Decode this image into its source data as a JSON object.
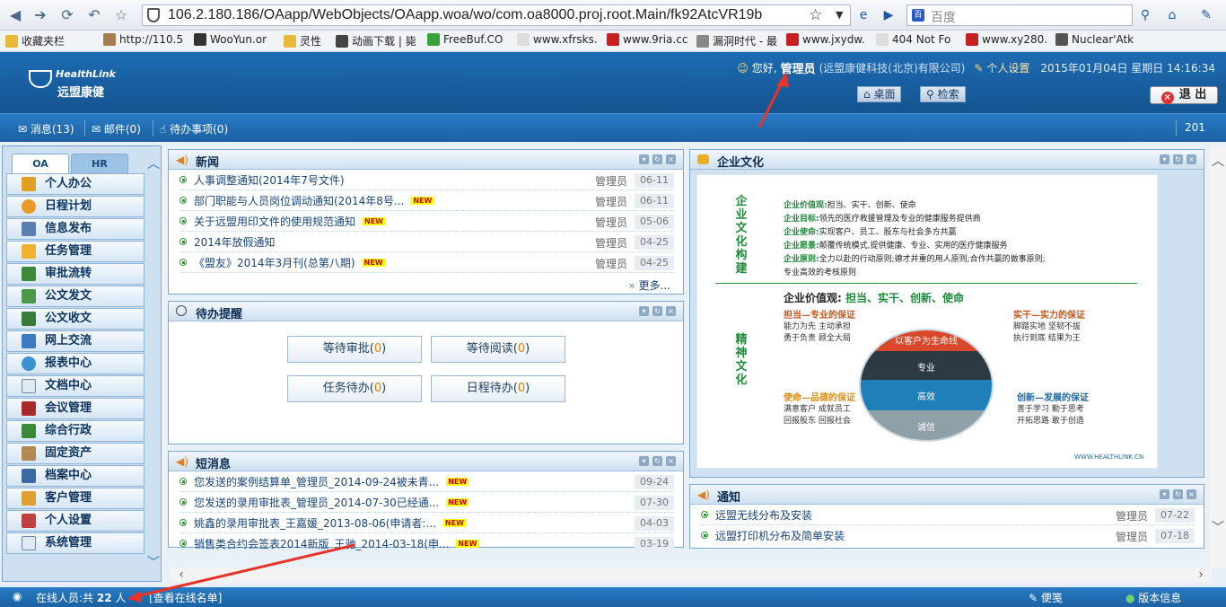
{
  "browser": {
    "url": "106.2.180.186/OAapp/WebObjects/OAapp.woa/wo/com.oa8000.proj.root.Main/fk92AtcVR19b",
    "search_placeholder": "百度",
    "bookmarks": [
      "收藏夹栏",
      "http://110.5",
      "WooYun.or",
      "灵性",
      "动画下载 | 毙",
      "FreeBuf.CO",
      "www.xfrsks.",
      "www.9ria.cc",
      "漏洞时代 - 最",
      "www.jxydw.",
      "404 Not Fo",
      "www.xy280.",
      "Nuclear'Atk"
    ]
  },
  "header": {
    "logo_en": "HealthLink",
    "logo_cn": "远盟康健",
    "greeting": "您好,",
    "username": "管理员",
    "company": "(远盟康健科技(北京)有限公司)",
    "settings": "个人设置",
    "datetime": "2015年01月04日 星期日 14:16:34",
    "desktop_btn": "桌面",
    "search_btn": "检索",
    "logout_btn": "退 出"
  },
  "toolbar": {
    "messages": "消息(13)",
    "mail": "邮件(0)",
    "todo": "待办事项(0)",
    "right_num": "201"
  },
  "sidebar": {
    "tabs": [
      "OA",
      "HR"
    ],
    "items": [
      "个人办公",
      "日程计划",
      "信息发布",
      "任务管理",
      "审批流转",
      "公文发文",
      "公文收文",
      "网上交流",
      "报表中心",
      "文档中心",
      "会议管理",
      "综合行政",
      "固定资产",
      "档案中心",
      "客户管理",
      "个人设置",
      "系统管理"
    ]
  },
  "news": {
    "title": "新闻",
    "rows": [
      {
        "title": "人事调整通知(2014年7号文件)",
        "who": "管理员",
        "date": "06-11",
        "new": ""
      },
      {
        "title": "部门职能与人员岗位调动通知(2014年8号...",
        "who": "管理员",
        "date": "06-11",
        "new": "NEW"
      },
      {
        "title": "关于远盟用印文件的使用规范通知",
        "who": "管理员",
        "date": "05-06",
        "new": "NEW"
      },
      {
        "title": "2014年放假通知",
        "who": "管理员",
        "date": "04-25",
        "new": ""
      },
      {
        "title": "《盟友》2014年3月刊(总第八期)",
        "who": "管理员",
        "date": "04-25",
        "new": "NEW"
      }
    ],
    "more": "更多..."
  },
  "todo": {
    "title": "待办提醒",
    "btn1_label": "等待审批",
    "btn1_count": "0",
    "btn2_label": "等待阅读",
    "btn2_count": "0",
    "btn3_label": "任务待办",
    "btn3_count": "0",
    "btn4_label": "日程待办",
    "btn4_count": "0"
  },
  "sms": {
    "title": "短消息",
    "rows": [
      {
        "title": "您发送的案例结算单_管理员_2014-09-24被未青...",
        "date": "09-24",
        "new": "NEW"
      },
      {
        "title": "您发送的录用审批表_管理员_2014-07-30已经通...",
        "date": "07-30",
        "new": "NEW"
      },
      {
        "title": "姚鑫的录用审批表_王嘉媛_2013-08-06(申请者:...",
        "date": "04-03",
        "new": "NEW"
      },
      {
        "title": "销售类合约会签表2014新版_王驰_2014-03-18(申...",
        "date": "03-19",
        "new": "NEW"
      }
    ]
  },
  "culture": {
    "title": "企业文化",
    "left1": "企业文化构建",
    "left2": "精神文化",
    "lines": [
      {
        "k": "企业价值观:",
        "v": "担当、实干、创新、使命"
      },
      {
        "k": "企业目标:",
        "v": "领先的医疗救援管理及专业的健康服务提供商"
      },
      {
        "k": "企业使命:",
        "v": "实现客户、员工、股东与社会多方共赢"
      },
      {
        "k": "企业愿景:",
        "v": "颠覆传统模式,提供健康、专业、实用的医疗健康服务"
      },
      {
        "k": "企业原则:",
        "v": "全力以赴的行动原则;德才并重的用人原则;合作共赢的做事原则;"
      },
      {
        "k": "",
        "v": "专业高效的考核原则"
      }
    ],
    "values_title": "企业价值观:",
    "values_hl": "担当、实干、创新、使命",
    "danding_h": "担当—专业的保证",
    "danding_1": "能力为先  主动承担",
    "danding_2": "勇于负责  顾全大局",
    "shigan_h": "实干—实力的保证",
    "shigan_1": "脚踏实地  坚韧不拔",
    "shigan_2": "执行到底  结果为王",
    "shiming_h": "使命—品德的保证",
    "shiming_1": "满意客户  成就员工",
    "shiming_2": "回报股东  回报社会",
    "chuangxin_h": "创新—发展的保证",
    "chuangxin_1": "善于学习  勤于思考",
    "chuangxin_2": "开拓思路  敢于创造",
    "band1": "以客户为生命线",
    "band2": "专业",
    "band3": "高效",
    "band4": "诚信",
    "site": "WWW.HEALTHLINK.CN"
  },
  "notice": {
    "title": "通知",
    "rows": [
      {
        "title": "远盟无线分布及安装",
        "who": "管理员",
        "date": "07-22"
      },
      {
        "title": "远盟打印机分布及简单安装",
        "who": "管理员",
        "date": "07-18"
      }
    ]
  },
  "status": {
    "online": "在线人员:共",
    "online_count": "22",
    "online_unit": "人",
    "view_list": "[查看在线名单]",
    "notes": "便笺",
    "version": "版本信息"
  },
  "colors": {
    "header_blue": "#1a61a3",
    "annotation_red": "#e8332a",
    "accent_green": "#1f8a3a"
  }
}
